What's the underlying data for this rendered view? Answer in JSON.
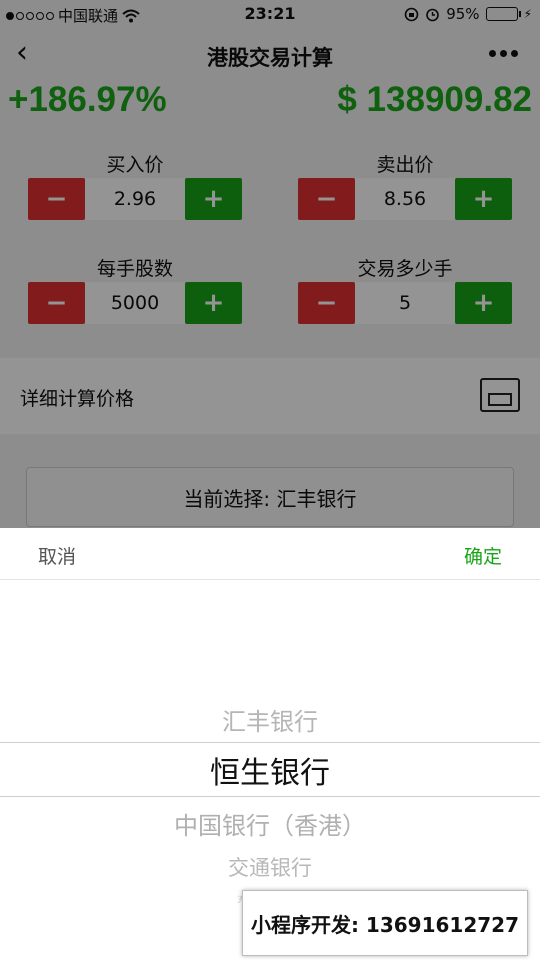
{
  "status_bar": {
    "carrier": "中国联通",
    "time": "23:21",
    "battery": "95%"
  },
  "nav": {
    "title": "港股交易计算"
  },
  "summary": {
    "percent": "+186.97%",
    "amount": "$ 138909.82"
  },
  "fields": {
    "buy_price": {
      "label": "买入价",
      "value": "2.96"
    },
    "sell_price": {
      "label": "卖出价",
      "value": "8.56"
    },
    "shares_per_lot": {
      "label": "每手股数",
      "value": "5000"
    },
    "lots": {
      "label": "交易多少手",
      "value": "5"
    },
    "minus": "−",
    "plus": "+"
  },
  "detail": {
    "label": "详细计算价格"
  },
  "selection": {
    "text": "当前选择: 汇丰银行"
  },
  "picker": {
    "cancel": "取消",
    "confirm": "确定",
    "options": [
      "汇丰银行",
      "恒生银行",
      "中国银行（香港）",
      "交通银行",
      "东亚银行"
    ],
    "selected": "恒生银行"
  },
  "watermark": {
    "text": "小程序开发: 13691612727"
  },
  "colors": {
    "green": "#18a418",
    "red": "#e13131"
  }
}
